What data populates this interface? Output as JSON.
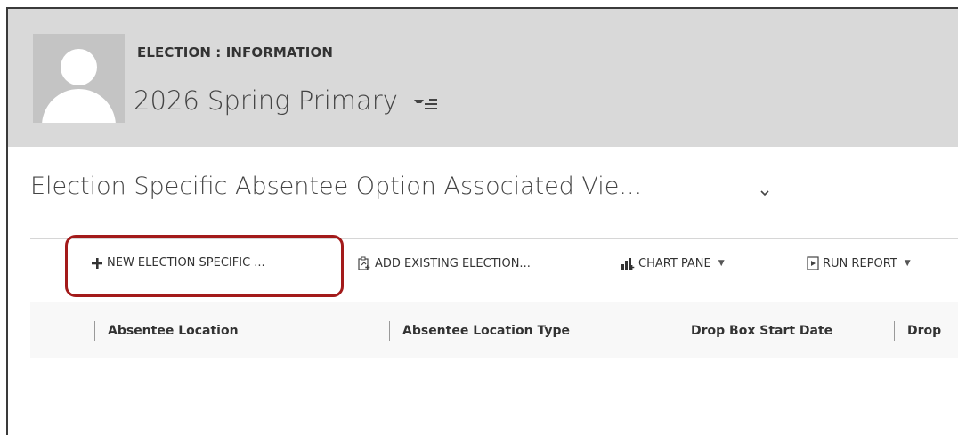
{
  "header": {
    "entity_label": "ELECTION : INFORMATION",
    "record_title": "2026 Spring Primary"
  },
  "section": {
    "title": "Election Specific Absentee Option Associated Vie..."
  },
  "commands": [
    {
      "label": "NEW ELECTION SPECIFIC ...",
      "icon": "plus-icon"
    },
    {
      "label": "ADD EXISTING ELECTION...",
      "icon": "add-existing-icon"
    },
    {
      "label": "CHART PANE",
      "icon": "chart-icon",
      "dropdown": true
    },
    {
      "label": "RUN REPORT",
      "icon": "report-icon",
      "dropdown": true
    }
  ],
  "grid": {
    "columns": [
      "Absentee Location",
      "Absentee Location Type",
      "Drop Box Start Date",
      "Drop"
    ]
  },
  "colors": {
    "header_bg": "#d9d9d9",
    "highlight_border": "#a31a1a",
    "text": "#333333"
  }
}
